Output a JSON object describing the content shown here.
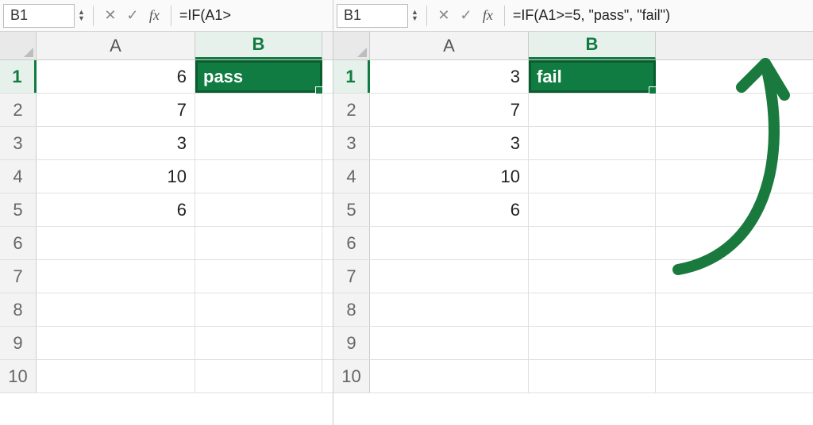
{
  "left": {
    "namebox": "B1",
    "formula": "=IF(A1>",
    "columns": [
      "A",
      "B"
    ],
    "selectedColumn": "B",
    "selectedRow": 1,
    "rows": [
      {
        "n": "1",
        "A": "6",
        "B": "pass"
      },
      {
        "n": "2",
        "A": "7",
        "B": ""
      },
      {
        "n": "3",
        "A": "3",
        "B": ""
      },
      {
        "n": "4",
        "A": "10",
        "B": ""
      },
      {
        "n": "5",
        "A": "6",
        "B": ""
      },
      {
        "n": "6",
        "A": "",
        "B": ""
      },
      {
        "n": "7",
        "A": "",
        "B": ""
      },
      {
        "n": "8",
        "A": "",
        "B": ""
      },
      {
        "n": "9",
        "A": "",
        "B": ""
      },
      {
        "n": "10",
        "A": "",
        "B": ""
      }
    ]
  },
  "right": {
    "namebox": "B1",
    "formula": "=IF(A1>=5, \"pass\", \"fail\")",
    "columns": [
      "A",
      "B"
    ],
    "selectedColumn": "B",
    "selectedRow": 1,
    "rows": [
      {
        "n": "1",
        "A": "3",
        "B": "fail"
      },
      {
        "n": "2",
        "A": "7",
        "B": ""
      },
      {
        "n": "3",
        "A": "3",
        "B": ""
      },
      {
        "n": "4",
        "A": "10",
        "B": ""
      },
      {
        "n": "5",
        "A": "6",
        "B": ""
      },
      {
        "n": "6",
        "A": "",
        "B": ""
      },
      {
        "n": "7",
        "A": "",
        "B": ""
      },
      {
        "n": "8",
        "A": "",
        "B": ""
      },
      {
        "n": "9",
        "A": "",
        "B": ""
      },
      {
        "n": "10",
        "A": "",
        "B": ""
      }
    ]
  },
  "icons": {
    "cancel": "✕",
    "confirm": "✓",
    "fx": "fx",
    "up": "▲",
    "down": "▼"
  },
  "accent": "#107c41"
}
